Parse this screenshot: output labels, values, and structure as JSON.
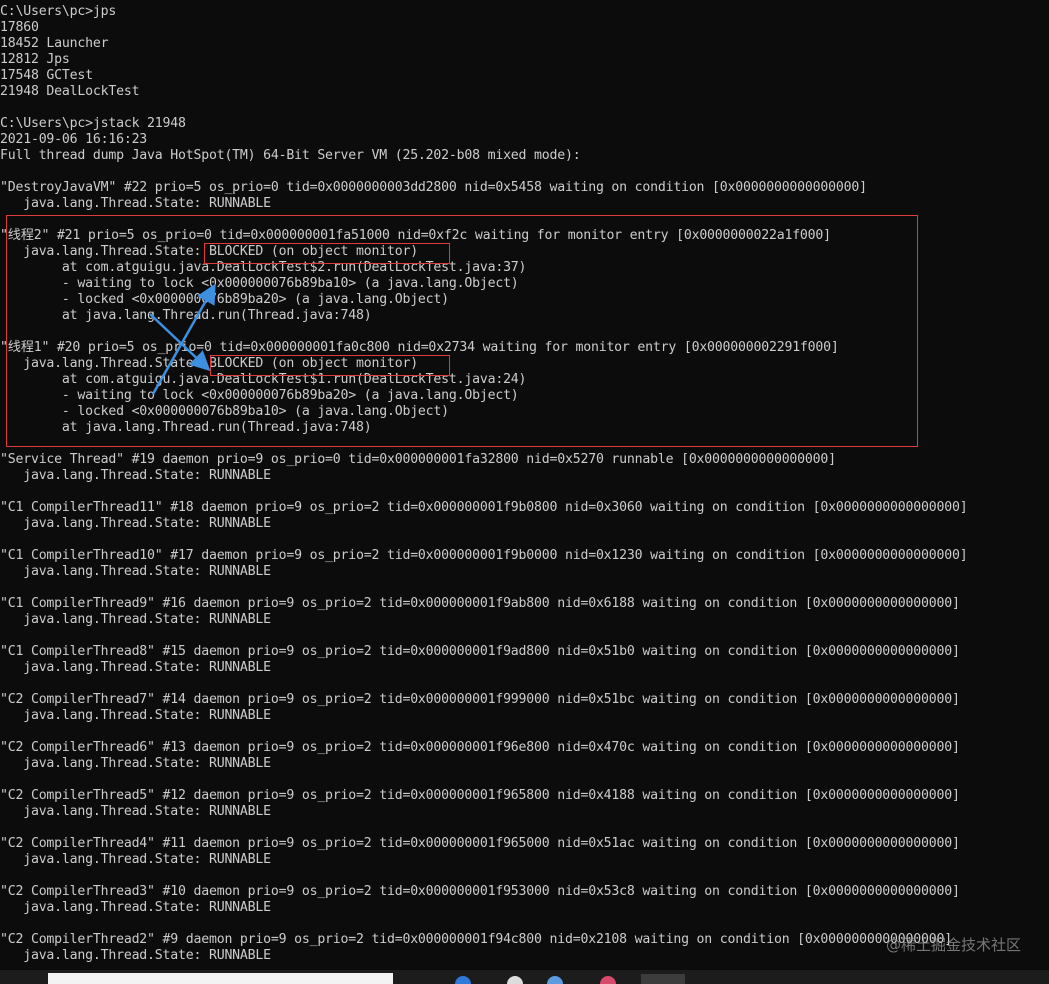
{
  "console": {
    "lines": [
      "C:\\Users\\pc>jps",
      "17860",
      "18452 Launcher",
      "12812 Jps",
      "17548 GCTest",
      "21948 DealLockTest",
      "",
      "C:\\Users\\pc>jstack 21948",
      "2021-09-06 16:16:23",
      "Full thread dump Java HotSpot(TM) 64-Bit Server VM (25.202-b08 mixed mode):",
      "",
      "\"DestroyJavaVM\" #22 prio=5 os_prio=0 tid=0x0000000003dd2800 nid=0x5458 waiting on condition [0x0000000000000000]",
      "   java.lang.Thread.State: RUNNABLE",
      "",
      "\"线程2\" #21 prio=5 os_prio=0 tid=0x000000001fa51000 nid=0xf2c waiting for monitor entry [0x0000000022a1f000]",
      "   java.lang.Thread.State: BLOCKED (on object monitor)",
      "        at com.atguigu.java.DealLockTest$2.run(DealLockTest.java:37)",
      "        - waiting to lock <0x000000076b89ba10> (a java.lang.Object)",
      "        - locked <0x000000076b89ba20> (a java.lang.Object)",
      "        at java.lang.Thread.run(Thread.java:748)",
      "",
      "\"线程1\" #20 prio=5 os_prio=0 tid=0x000000001fa0c800 nid=0x2734 waiting for monitor entry [0x000000002291f000]",
      "   java.lang.Thread.State: BLOCKED (on object monitor)",
      "        at com.atguigu.java.DealLockTest$1.run(DealLockTest.java:24)",
      "        - waiting to lock <0x000000076b89ba20> (a java.lang.Object)",
      "        - locked <0x000000076b89ba10> (a java.lang.Object)",
      "        at java.lang.Thread.run(Thread.java:748)",
      "",
      "\"Service Thread\" #19 daemon prio=9 os_prio=0 tid=0x000000001fa32800 nid=0x5270 runnable [0x0000000000000000]",
      "   java.lang.Thread.State: RUNNABLE",
      "",
      "\"C1 CompilerThread11\" #18 daemon prio=9 os_prio=2 tid=0x000000001f9b0800 nid=0x3060 waiting on condition [0x0000000000000000]",
      "   java.lang.Thread.State: RUNNABLE",
      "",
      "\"C1 CompilerThread10\" #17 daemon prio=9 os_prio=2 tid=0x000000001f9b0000 nid=0x1230 waiting on condition [0x0000000000000000]",
      "   java.lang.Thread.State: RUNNABLE",
      "",
      "\"C1 CompilerThread9\" #16 daemon prio=9 os_prio=2 tid=0x000000001f9ab800 nid=0x6188 waiting on condition [0x0000000000000000]",
      "   java.lang.Thread.State: RUNNABLE",
      "",
      "\"C1 CompilerThread8\" #15 daemon prio=9 os_prio=2 tid=0x000000001f9ad800 nid=0x51b0 waiting on condition [0x0000000000000000]",
      "   java.lang.Thread.State: RUNNABLE",
      "",
      "\"C2 CompilerThread7\" #14 daemon prio=9 os_prio=2 tid=0x000000001f999000 nid=0x51bc waiting on condition [0x0000000000000000]",
      "   java.lang.Thread.State: RUNNABLE",
      "",
      "\"C2 CompilerThread6\" #13 daemon prio=9 os_prio=2 tid=0x000000001f96e800 nid=0x470c waiting on condition [0x0000000000000000]",
      "   java.lang.Thread.State: RUNNABLE",
      "",
      "\"C2 CompilerThread5\" #12 daemon prio=9 os_prio=2 tid=0x000000001f965800 nid=0x4188 waiting on condition [0x0000000000000000]",
      "   java.lang.Thread.State: RUNNABLE",
      "",
      "\"C2 CompilerThread4\" #11 daemon prio=9 os_prio=2 tid=0x000000001f965000 nid=0x51ac waiting on condition [0x0000000000000000]",
      "   java.lang.Thread.State: RUNNABLE",
      "",
      "\"C2 CompilerThread3\" #10 daemon prio=9 os_prio=2 tid=0x000000001f953000 nid=0x53c8 waiting on condition [0x0000000000000000]",
      "   java.lang.Thread.State: RUNNABLE",
      "",
      "\"C2 CompilerThread2\" #9 daemon prio=9 os_prio=2 tid=0x000000001f94c800 nid=0x2108 waiting on condition [0x0000000000000000]",
      "   java.lang.Thread.State: RUNNABLE"
    ]
  },
  "watermark": "@稀土掘金技术社区",
  "colors": {
    "background": "#0c0c0c",
    "text": "#cccccc",
    "highlight_box": "#e03a3a",
    "arrow": "#3d8fe0"
  }
}
